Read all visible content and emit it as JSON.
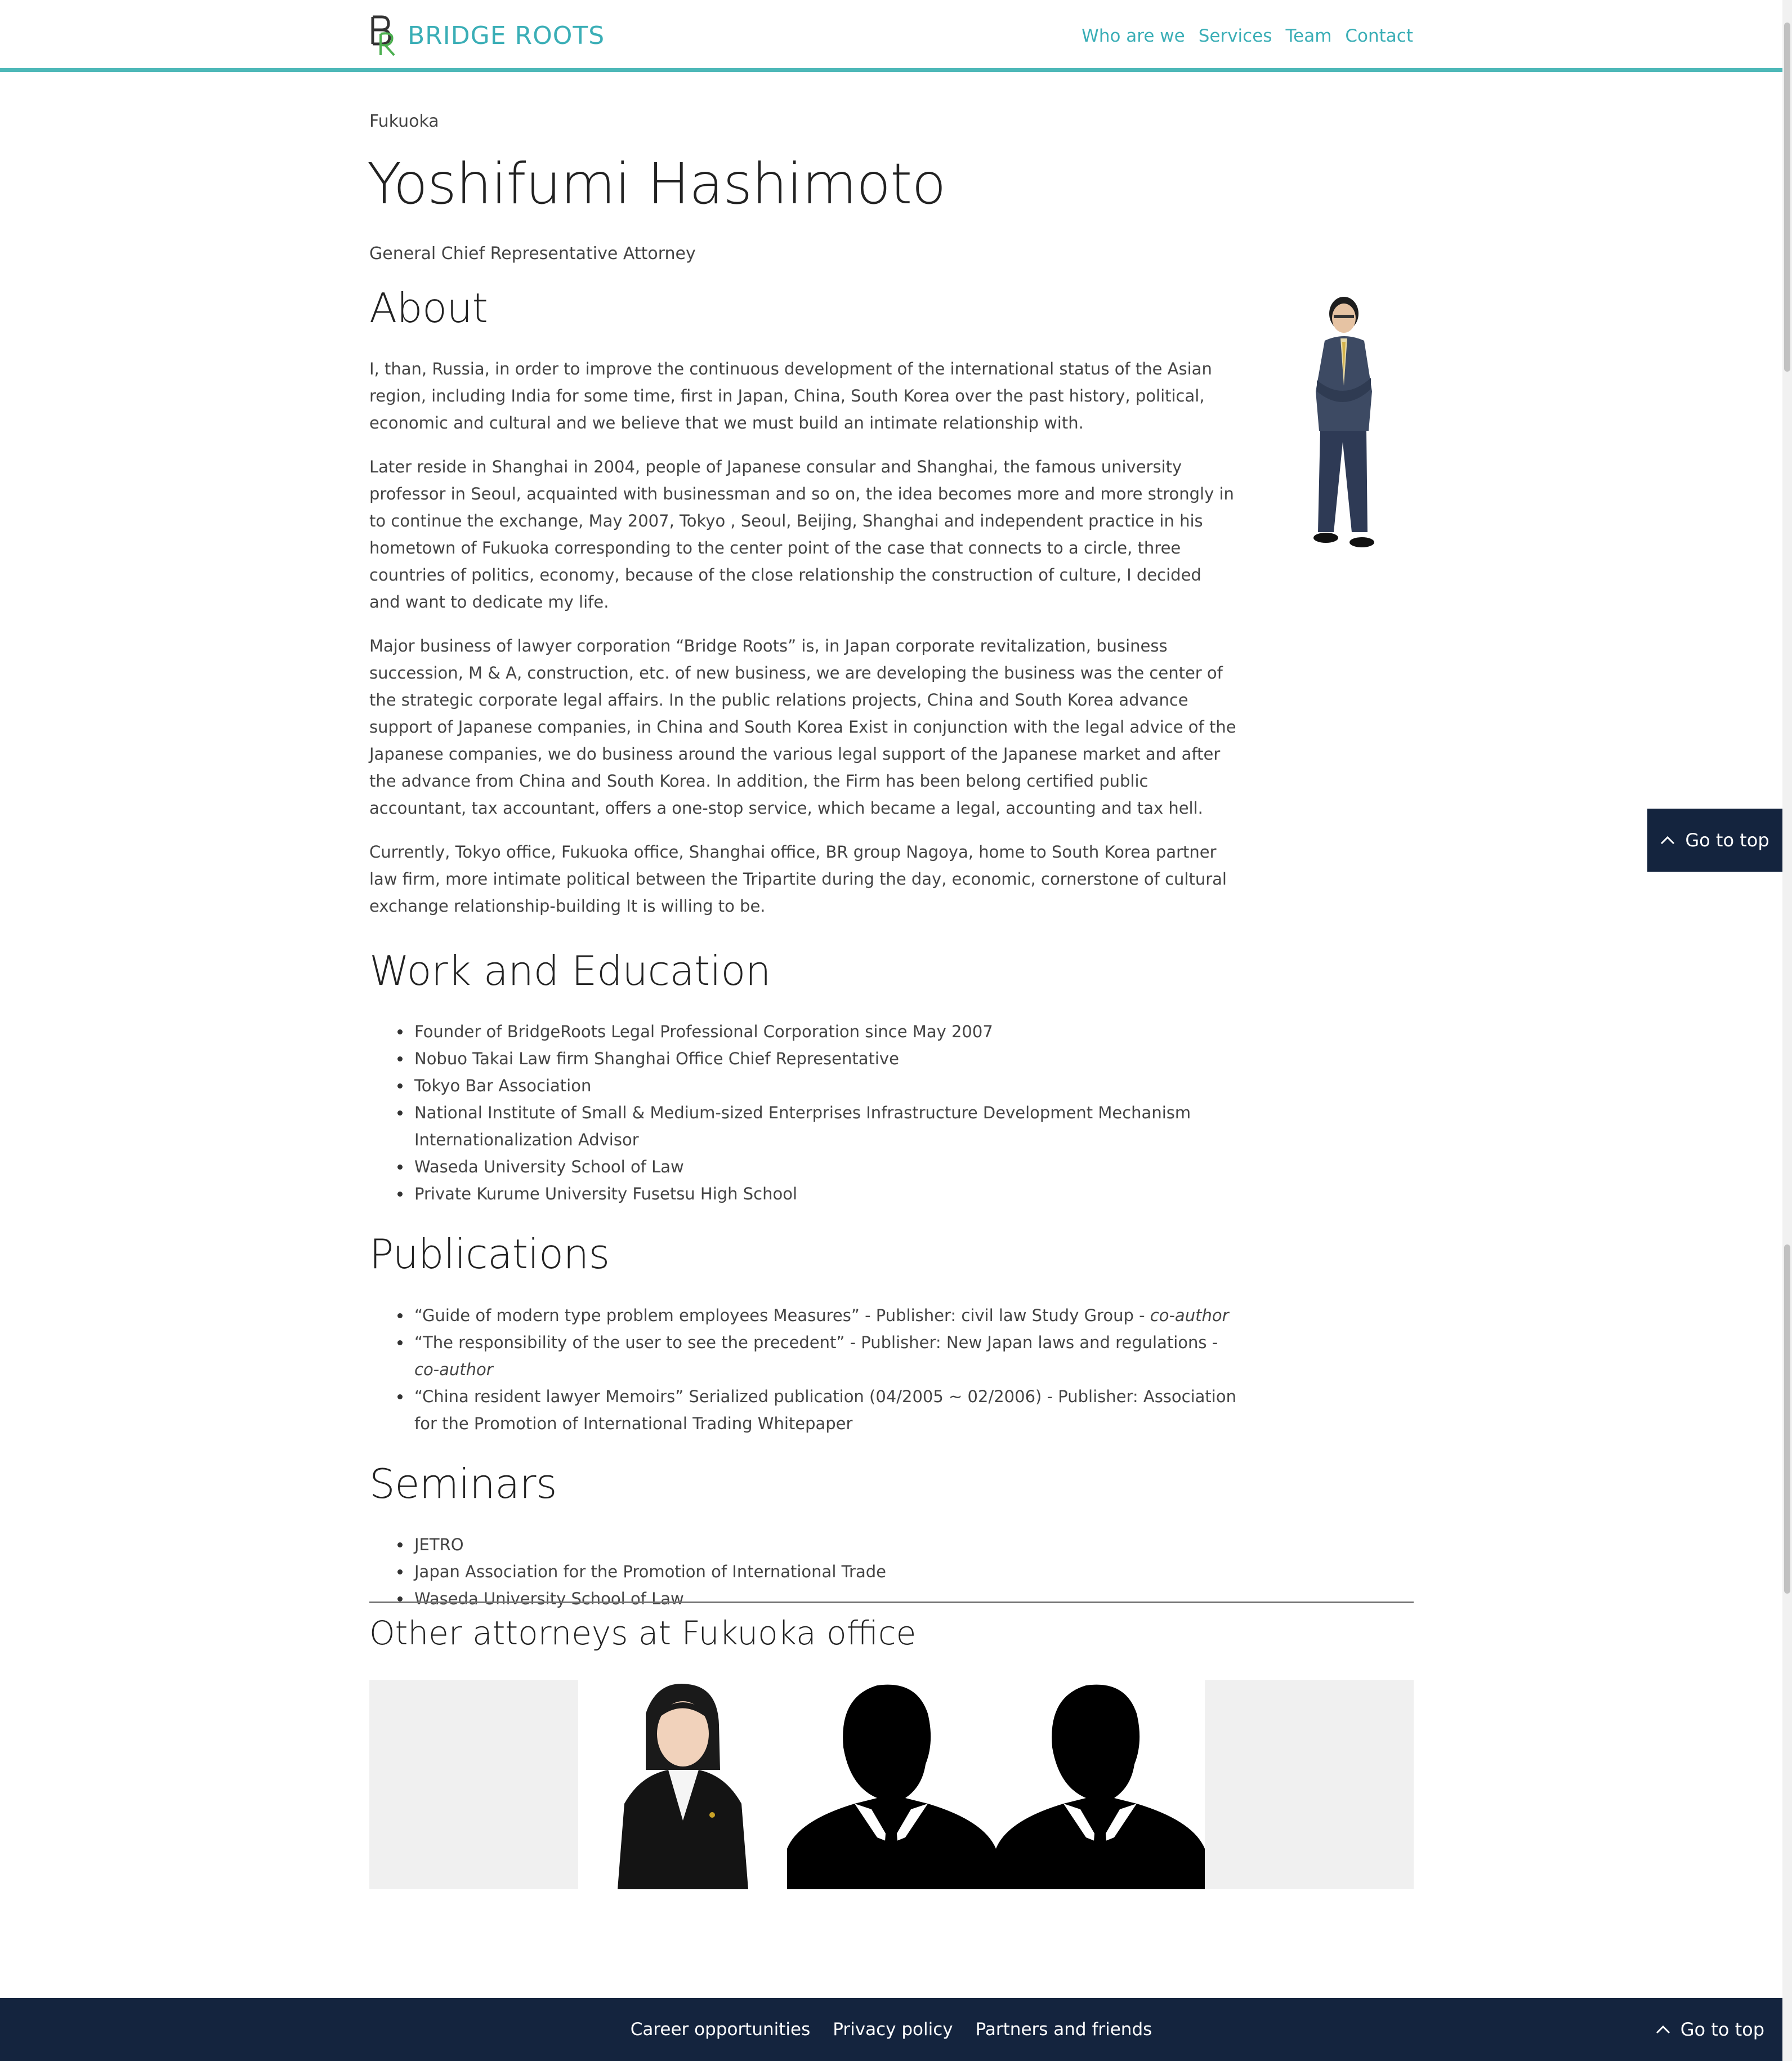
{
  "header": {
    "brand": "BRIDGE ROOTS",
    "nav": [
      "Who are we",
      "Services",
      "Team",
      "Contact"
    ],
    "accent_color": "#4db8b8"
  },
  "profile": {
    "location": "Fukuoka",
    "name": "Yoshifumi Hashimoto",
    "title": "General Chief Representative Attorney"
  },
  "about": {
    "heading": "About",
    "paragraphs": [
      "I, than, Russia, in order to improve the continuous development of the international status of the Asian region, including India for some time, first in Japan, China, South Korea over the past history, political, economic and cultural and we believe that we must build an intimate relationship with.",
      "Later reside in Shanghai in 2004, people of Japanese consular and Shanghai, the famous university professor in Seoul, acquainted with businessman and so on, the idea becomes more and more strongly in to continue the exchange, May 2007, Tokyo , Seoul, Beijing, Shanghai and independent practice in his hometown of Fukuoka corresponding to the center point of the case that connects to a circle, three countries of politics, economy, because of the close relationship the construction of culture, I decided and want to dedicate my life.",
      "Major business of lawyer corporation “Bridge Roots” is, in Japan corporate revitalization, business succession, M & A, construction, etc. of new business, we are developing the business was the center of the strategic corporate legal affairs. In the public relations projects, China and South Korea advance support of Japanese companies, in China and South Korea Exist in conjunction with the legal advice of the Japanese companies, we do business around the various legal support of the Japanese market and after the advance from China and South Korea. In addition, the Firm has been belong certified public accountant, tax accountant, offers a one-stop service, which became a legal, accounting and tax hell.",
      "Currently, Tokyo office, Fukuoka office, Shanghai office, BR group Nagoya, home to South Korea partner law firm, more intimate political between the Tripartite during the day, economic, cornerstone of cultural exchange relationship-building It is willing to be."
    ]
  },
  "work": {
    "heading": "Work and Education",
    "items": [
      "Founder of BridgeRoots Legal Professional Corporation since May 2007",
      "Nobuo Takai Law firm Shanghai Office Chief Representative",
      "Tokyo Bar Association",
      "National Institute of Small & Medium-sized Enterprises Infrastructure Development Mechanism Internationalization Advisor",
      "Waseda University School of Law",
      "Private Kurume University Fusetsu High School"
    ]
  },
  "publications": {
    "heading": "Publications",
    "items": [
      {
        "text": "“Guide of modern type problem employees Measures” - Publisher: civil law Study Group - ",
        "em": "co-author"
      },
      {
        "text": "“The responsibility of the user to see the precedent” - Publisher: New Japan laws and regulations - ",
        "em": "co-author"
      },
      {
        "text": "“China resident lawyer Memoirs” Serialized publication (04/2005 ~ 02/2006) - Publisher: Association for the Promotion of International Trading Whitepaper",
        "em": ""
      }
    ]
  },
  "seminars": {
    "heading": "Seminars",
    "items": [
      "JETRO",
      "Japan Association for the Promotion of International Trade",
      "Waseda University School of Law"
    ]
  },
  "others": {
    "heading": "Other attorneys at Fukuoka office"
  },
  "goto_top": "Go to top",
  "footer": {
    "links": [
      "Career opportunities",
      "Privacy policy",
      "Partners and friends"
    ],
    "goto_top": "Go to top",
    "bg_color": "#14243e"
  }
}
